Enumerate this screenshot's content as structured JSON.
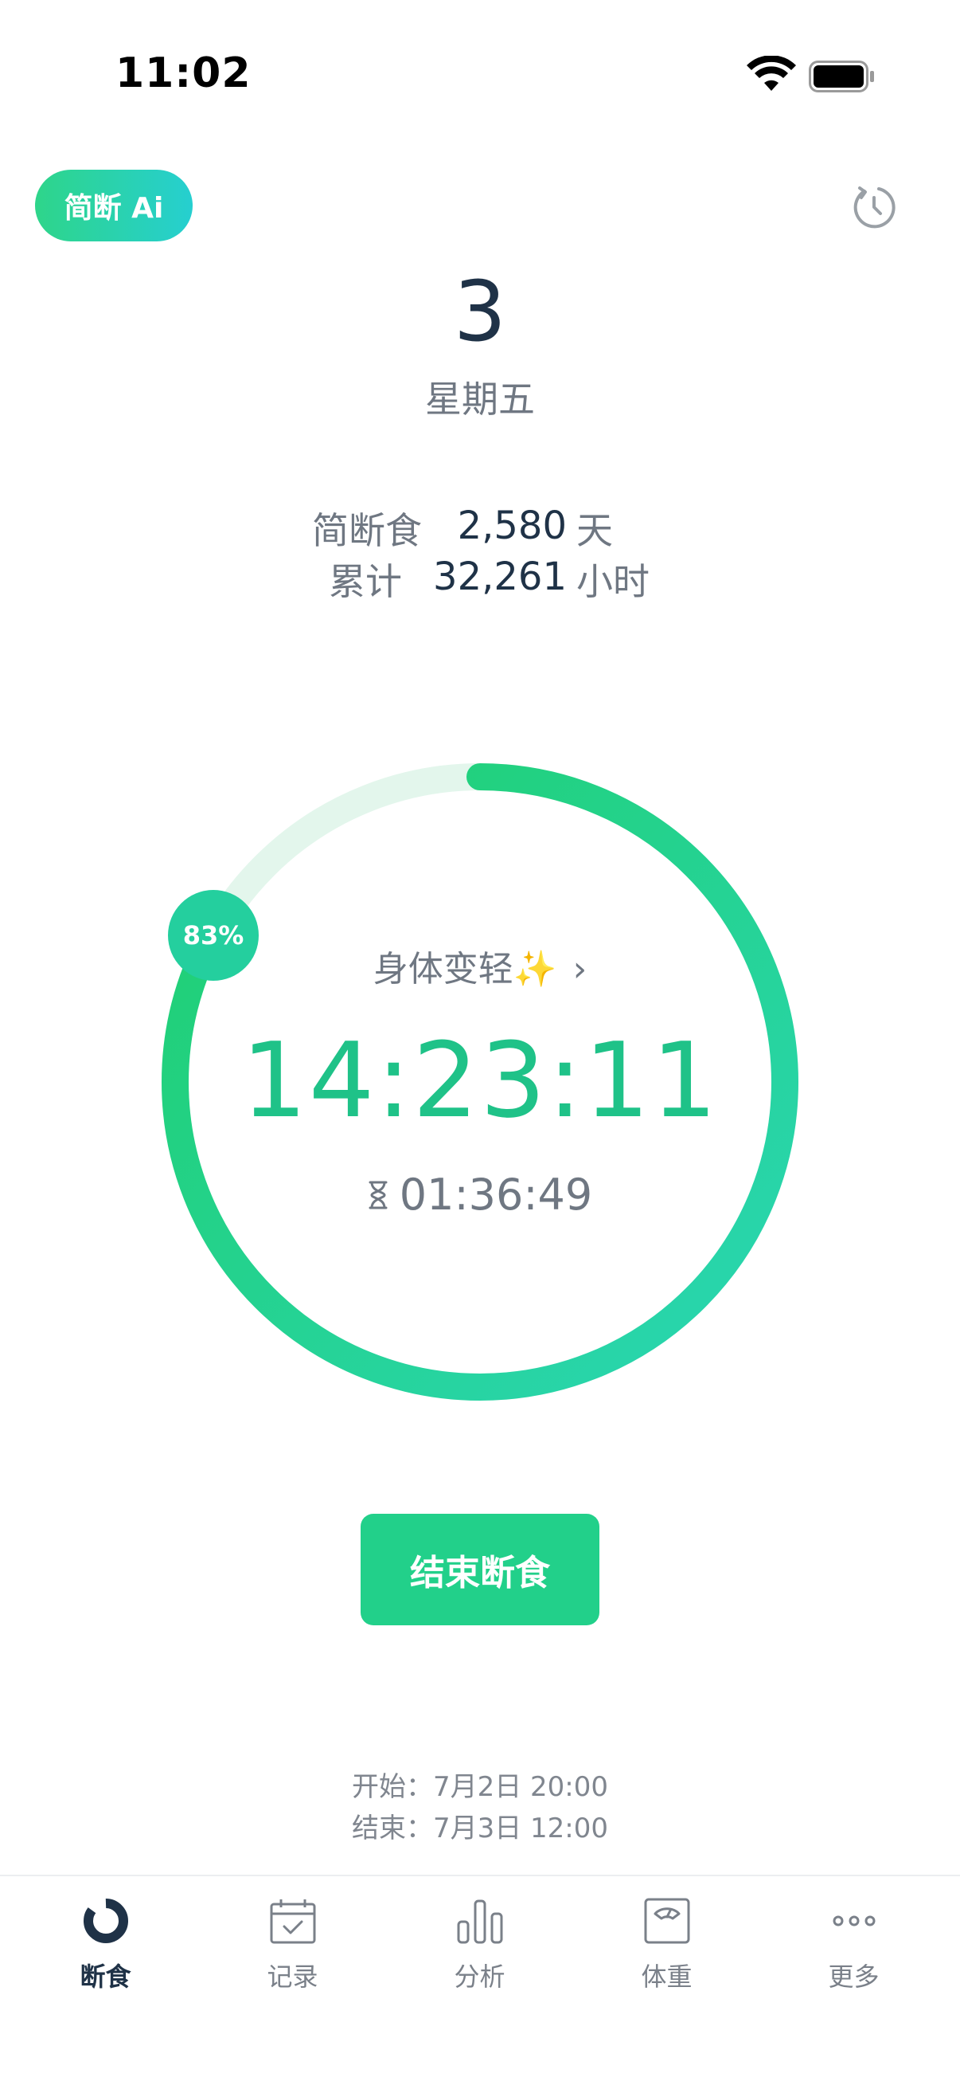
{
  "status_bar": {
    "time": "11:02"
  },
  "header": {
    "ai_button": "简断 Ai"
  },
  "date": {
    "day": "3",
    "weekday": "星期五"
  },
  "stats": {
    "days_label": "简断食",
    "days_value": "2,580",
    "days_unit": "天",
    "hours_label": "累计",
    "hours_value": "32,261",
    "hours_unit": "小时"
  },
  "progress": {
    "percent_label": "83%",
    "fraction": 0.83,
    "phase": "身体变轻✨",
    "elapsed": "14:23:11",
    "remaining": "01:36:49",
    "colors": {
      "track": "#e3f6ec",
      "start": "#2ad6b4",
      "end": "#1fcf6e"
    }
  },
  "actions": {
    "end_label": "结束断食"
  },
  "schedule": {
    "start": "开始：7月2日 20:00",
    "end": "结束：7月3日 12:00"
  },
  "tabs": [
    {
      "label": "断食",
      "icon": "fasting-ring-icon",
      "active": true
    },
    {
      "label": "记录",
      "icon": "calendar-check-icon",
      "active": false
    },
    {
      "label": "分析",
      "icon": "bar-chart-icon",
      "active": false
    },
    {
      "label": "体重",
      "icon": "scale-icon",
      "active": false
    },
    {
      "label": "更多",
      "icon": "more-dots-icon",
      "active": false
    }
  ]
}
